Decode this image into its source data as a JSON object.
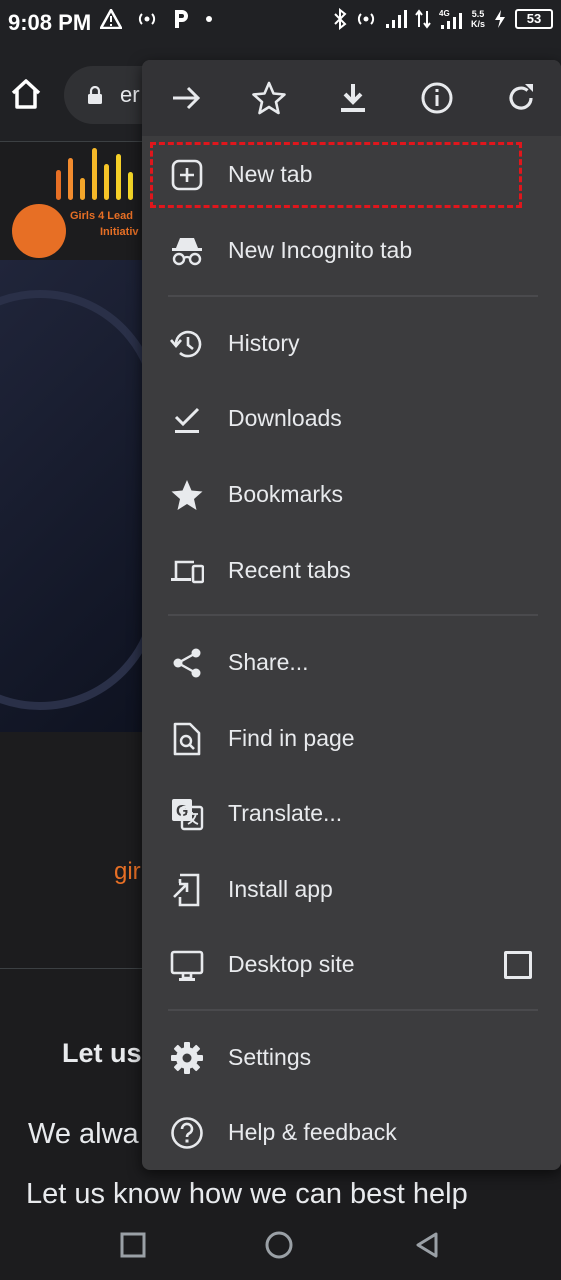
{
  "status_bar": {
    "time": "9:08 PM",
    "speed_top": "5.5",
    "speed_bottom": "K/s",
    "battery": "53",
    "network_label": "4G"
  },
  "toolbar": {
    "url_partial": "er"
  },
  "page": {
    "logo_text_1": "Girls 4 Lead",
    "logo_text_2": "Initiativ",
    "link_partial": "gir",
    "heading_partial": "Let us",
    "para_partial": "We alwa",
    "para_line": "Let us know how we can best help"
  },
  "menu": {
    "top_icons": [
      "forward-icon",
      "star-icon",
      "download-icon",
      "info-icon",
      "reload-icon"
    ],
    "items": [
      {
        "label": "New tab",
        "icon": "plus-box-icon"
      },
      {
        "label": "New Incognito tab",
        "icon": "incognito-icon"
      },
      {
        "label": "History",
        "icon": "history-icon"
      },
      {
        "label": "Downloads",
        "icon": "downloads-icon"
      },
      {
        "label": "Bookmarks",
        "icon": "bookmark-star-icon"
      },
      {
        "label": "Recent tabs",
        "icon": "devices-icon"
      },
      {
        "label": "Share...",
        "icon": "share-icon"
      },
      {
        "label": "Find in page",
        "icon": "find-in-page-icon"
      },
      {
        "label": "Translate...",
        "icon": "translate-icon"
      },
      {
        "label": "Install app",
        "icon": "install-app-icon"
      },
      {
        "label": "Desktop site",
        "icon": "desktop-icon"
      },
      {
        "label": "Settings",
        "icon": "gear-icon"
      },
      {
        "label": "Help & feedback",
        "icon": "help-icon"
      }
    ],
    "desktop_site_checked": false,
    "highlight_color": "#e0161c"
  },
  "colors": {
    "accent_orange": "#e76f25",
    "menu_bg": "#3c3c3e"
  }
}
